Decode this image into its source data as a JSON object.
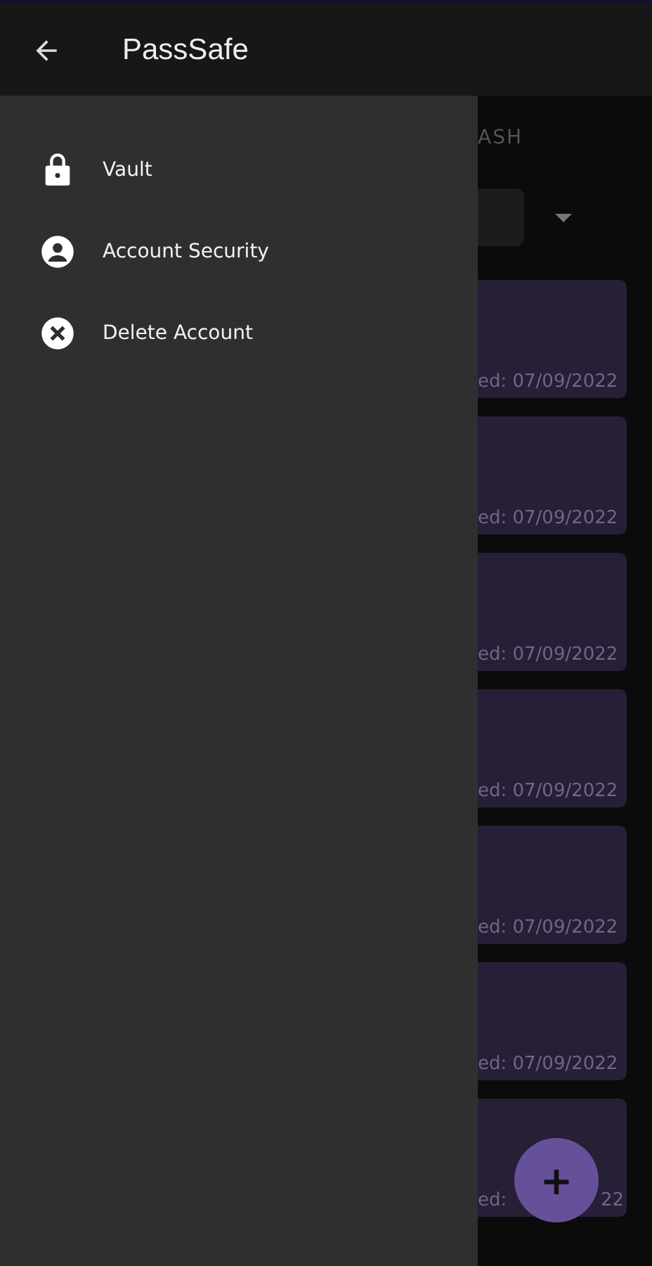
{
  "app_bar": {
    "title": "PassSafe"
  },
  "drawer": {
    "items": [
      {
        "label": "Vault",
        "kind": "lock"
      },
      {
        "label": "Account Security",
        "kind": "account"
      },
      {
        "label": "Delete Account",
        "kind": "delete"
      }
    ]
  },
  "background": {
    "tab_label": "ASH",
    "cards": [
      {
        "date_parts": [
          "ed: 07/09/2022"
        ]
      },
      {
        "date_parts": [
          "ed: 07/09/2022"
        ]
      },
      {
        "date_parts": [
          "ed: 07/09/2022"
        ]
      },
      {
        "date_parts": [
          "ed: 07/09/2022"
        ]
      },
      {
        "date_parts": [
          "ed: 07/09/2022"
        ]
      },
      {
        "date_parts": [
          "ed: 07/09/2022"
        ]
      },
      {
        "date_parts": [
          "ed:",
          "22"
        ]
      }
    ]
  },
  "fab": {
    "label": "+"
  }
}
